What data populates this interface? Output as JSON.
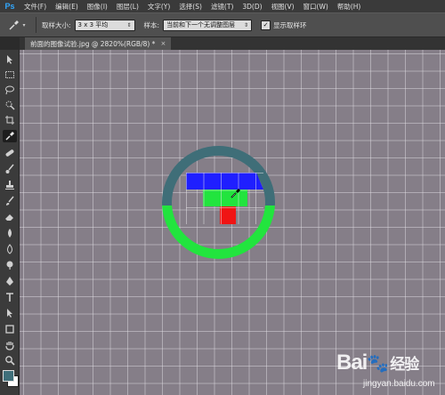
{
  "app": {
    "logo": "Ps"
  },
  "menu": {
    "items": [
      "文件(F)",
      "编辑(E)",
      "图像(I)",
      "图层(L)",
      "文字(Y)",
      "选择(S)",
      "滤镜(T)",
      "3D(D)",
      "视图(V)",
      "窗口(W)",
      "帮助(H)"
    ]
  },
  "options": {
    "sample_size_label": "取样大小:",
    "sample_size_value": "3 x 3 平均",
    "sample_label": "样本:",
    "sample_value": "当前和下一个无调整图层",
    "show_ring_label": "显示取样环",
    "show_ring_checked": true
  },
  "document": {
    "tab_title": "前面的图像试验.jpg @ 2820%(RGB/8) *",
    "close_glyph": "×"
  },
  "toolbar": {
    "tools": [
      "move-tool",
      "marquee-tool",
      "lasso-tool",
      "quick-select-tool",
      "crop-tool",
      "eyedropper-tool",
      "healing-brush-tool",
      "brush-tool",
      "clone-stamp-tool",
      "history-brush-tool",
      "eraser-tool",
      "gradient-tool",
      "blur-tool",
      "dodge-tool",
      "pen-tool",
      "type-tool",
      "path-select-tool",
      "shape-tool",
      "hand-tool",
      "zoom-tool"
    ],
    "active_tool": "eyedropper-tool",
    "foreground_color": "#3f6f7a",
    "background_color": "#ffffff"
  },
  "canvas": {
    "background_color": "#857e88",
    "pixel_colors": {
      "blue": "#1f1fff",
      "green": "#22e43e",
      "red": "#f01414"
    },
    "sampling_ring": {
      "current_color": "#3f6e78",
      "previous_color": "#22e43e"
    }
  },
  "watermark": {
    "brand": "Bai",
    "brand_cn": "经验",
    "url": "jingyan.baidu.com"
  }
}
